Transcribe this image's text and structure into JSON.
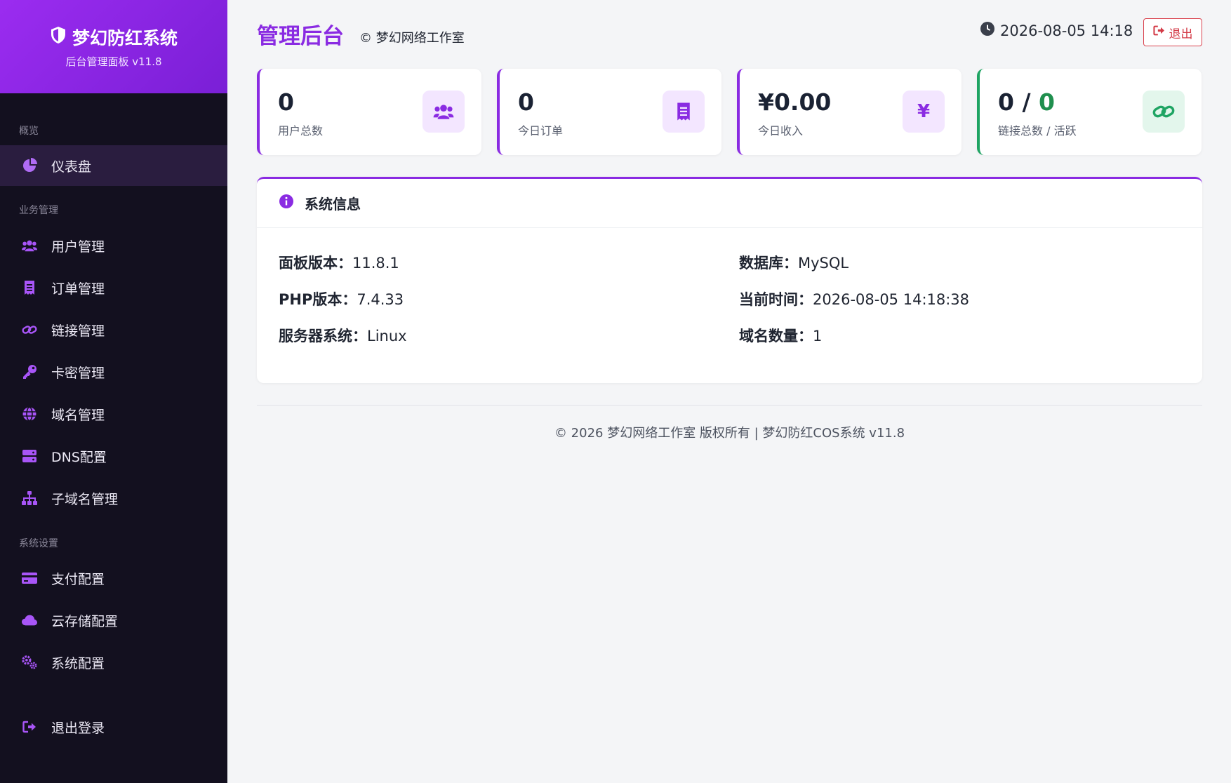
{
  "sidebar": {
    "brand_title": "梦幻防红系统",
    "brand_subtitle": "后台管理面板 v11.8",
    "sections": {
      "overview": "概览",
      "business": "业务管理",
      "settings": "系统设置"
    },
    "items": {
      "dashboard": "仪表盘",
      "users": "用户管理",
      "orders": "订单管理",
      "links": "链接管理",
      "cards": "卡密管理",
      "domains": "域名管理",
      "dns": "DNS配置",
      "subdomains": "子域名管理",
      "payment": "支付配置",
      "cloud_storage": "云存储配置",
      "system_config": "系统配置",
      "logout": "退出登录"
    }
  },
  "header": {
    "title": "管理后台",
    "copyright": "© 梦幻网络工作室",
    "datetime": "2026-08-05 14:18",
    "logout_label": "退出"
  },
  "stats": {
    "users": {
      "value": "0",
      "label": "用户总数",
      "icon": "users-icon"
    },
    "orders": {
      "value": "0",
      "label": "今日订单",
      "icon": "receipt-icon"
    },
    "income": {
      "value": "¥0.00",
      "label": "今日收入",
      "icon": "yen-icon"
    },
    "links": {
      "value_total": "0 /",
      "value_active": "0",
      "label": "链接总数 / 活跃",
      "icon": "link-icon"
    }
  },
  "system_info": {
    "title": "系统信息",
    "panel_version_label": "面板版本：",
    "panel_version": "11.8.1",
    "php_label": "PHP版本：",
    "php_version": "7.4.33",
    "os_label": "服务器系统：",
    "os": "Linux",
    "db_label": "数据库：",
    "db": "MySQL",
    "time_label": "当前时间：",
    "time": "2026-08-05 14:18:38",
    "domains_label": "域名数量：",
    "domains": "1"
  },
  "footer": {
    "text": "© 2026 梦幻网络工作室 版权所有 | 梦幻防红COS系统 v11.8"
  },
  "colors": {
    "accent": "#8a2be2",
    "sidebar_bg": "#13101f",
    "success": "#1f8f4e",
    "danger": "#d33a46"
  }
}
